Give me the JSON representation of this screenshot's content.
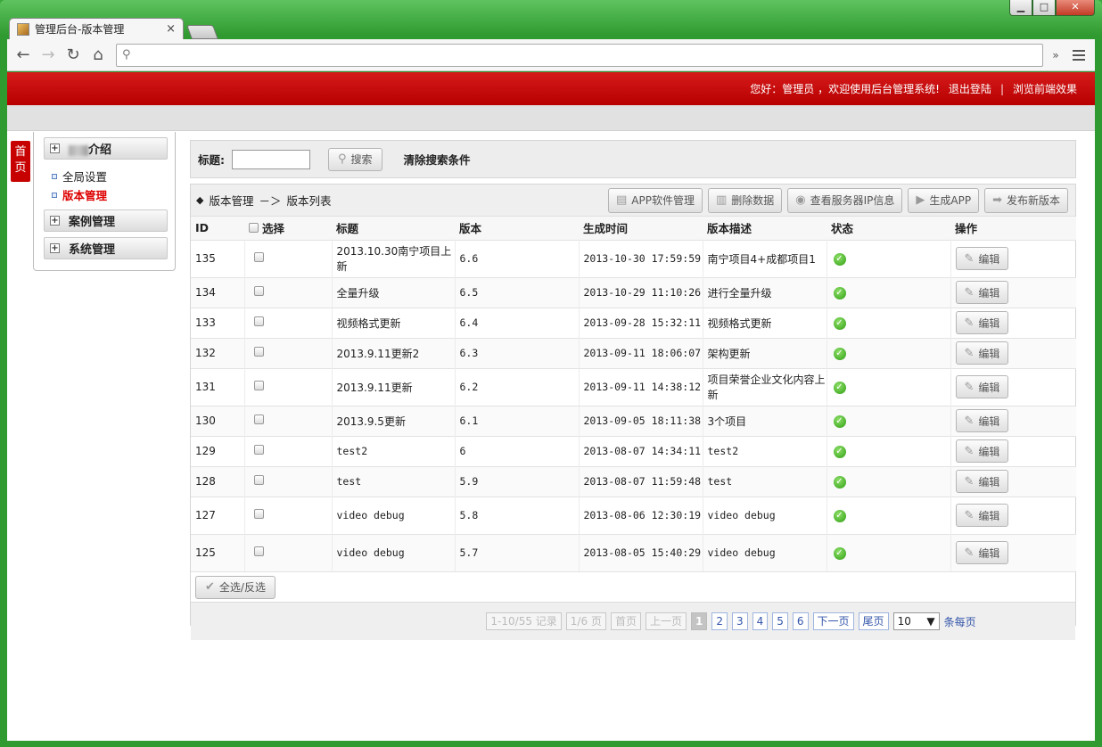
{
  "browser": {
    "tab_title": "管理后台-版本管理",
    "tab_close": "×",
    "win_min": "▁",
    "win_max": "□",
    "win_close": "✕",
    "overflow": "»",
    "url": ""
  },
  "header": {
    "greeting": "您好：管理员 ，欢迎使用后台管理系统!",
    "logout": "退出登陆",
    "separator": "|",
    "preview": "浏览前端效果"
  },
  "home_badge": "首页",
  "sidebar": {
    "sections": [
      {
        "label": "介绍",
        "prefix_blurred": true
      },
      {
        "label": "案例管理"
      },
      {
        "label": "系统管理"
      }
    ],
    "subitems": [
      {
        "label": "全局设置",
        "active": false
      },
      {
        "label": "版本管理",
        "active": true
      }
    ]
  },
  "search": {
    "title_label": "标题:",
    "title_value": "",
    "search_button": "搜索",
    "clear_link": "清除搜索条件"
  },
  "breadcrumb": {
    "diamond": "◆",
    "root": "版本管理",
    "arrow": "－＞",
    "leaf": "版本列表"
  },
  "actions": {
    "app_software": "APP软件管理",
    "delete_data": "删除数据",
    "view_server_ip": "查看服务器IP信息",
    "generate_app": "生成APP",
    "publish_version": "发布新版本"
  },
  "table": {
    "headers": {
      "id": "ID",
      "select": "选择",
      "title": "标题",
      "version": "版本",
      "generated": "生成时间",
      "description": "版本描述",
      "status": "状态",
      "ops": "操作"
    },
    "edit_label": "编辑",
    "rows": [
      {
        "id": "135",
        "title": "2013.10.30南宁项目上新",
        "version": "6.6",
        "time": "2013-10-30 17:59:59",
        "desc": "南宁项目4+成都项目1"
      },
      {
        "id": "134",
        "title": "全量升级",
        "version": "6.5",
        "time": "2013-10-29 11:10:26",
        "desc": "进行全量升级"
      },
      {
        "id": "133",
        "title": "视频格式更新",
        "version": "6.4",
        "time": "2013-09-28 15:32:11",
        "desc": "视频格式更新"
      },
      {
        "id": "132",
        "title": "2013.9.11更新2",
        "version": "6.3",
        "time": "2013-09-11 18:06:07",
        "desc": "架构更新"
      },
      {
        "id": "131",
        "title": "2013.9.11更新",
        "version": "6.2",
        "time": "2013-09-11 14:38:12",
        "desc": "项目荣誉企业文化内容上新"
      },
      {
        "id": "130",
        "title": "2013.9.5更新",
        "version": "6.1",
        "time": "2013-09-05 18:11:38",
        "desc": "3个项目"
      },
      {
        "id": "129",
        "title": "test2",
        "version": "6",
        "time": "2013-08-07 14:34:11",
        "desc": "test2"
      },
      {
        "id": "128",
        "title": "test",
        "version": "5.9",
        "time": "2013-08-07 11:59:48",
        "desc": "test"
      },
      {
        "id": "127",
        "title": "video debug",
        "version": "5.8",
        "time": "2013-08-06 12:30:19",
        "desc": "video debug"
      },
      {
        "id": "125",
        "title": "video debug",
        "version": "5.7",
        "time": "2013-08-05 15:40:29",
        "desc": "video debug"
      }
    ]
  },
  "select_all": "全选/反选",
  "pager": {
    "records": "1-10/55 记录",
    "pages": "1/6 页",
    "first": "首页",
    "prev": "上一页",
    "numbers": [
      "1",
      "2",
      "3",
      "4",
      "5",
      "6"
    ],
    "current": "1",
    "next": "下一页",
    "last": "尾页",
    "per_page_value": "10",
    "per_page_label": "条每页"
  },
  "colors": {
    "header_red": "#c70000",
    "active_red": "#dd0000",
    "link_blue": "#3355aa"
  }
}
